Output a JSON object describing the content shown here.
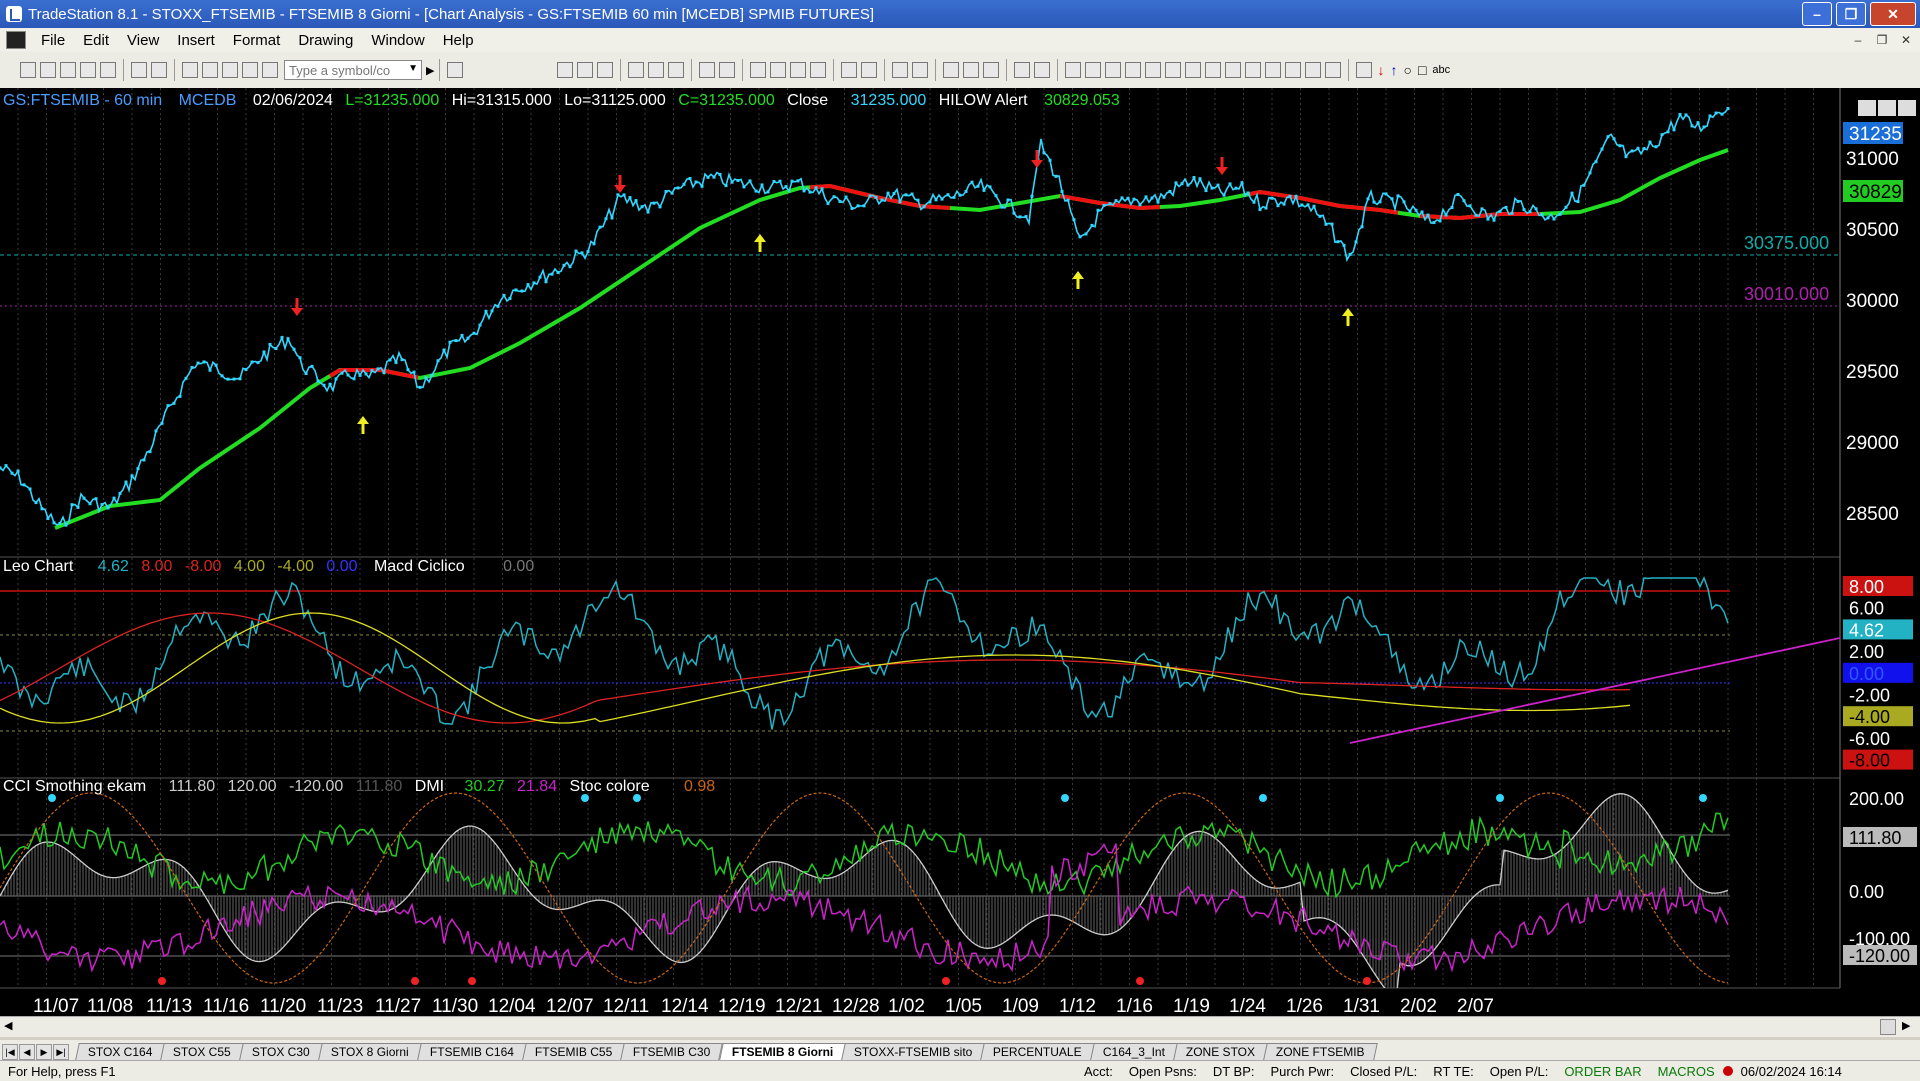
{
  "window": {
    "title": "TradeStation 8.1 - STOXX_FTSEMIB - FTSEMIB  8 Giorni - [Chart Analysis - GS:FTSEMIB  60 min  [MCEDB] SPMIB FUTURES]",
    "minimize": "–",
    "maximize": "❐",
    "close": "✕"
  },
  "menu": {
    "items": [
      "File",
      "Edit",
      "View",
      "Insert",
      "Format",
      "Drawing",
      "Window",
      "Help"
    ]
  },
  "toolbar": {
    "symbol_placeholder": "Type a symbol/co"
  },
  "chart": {
    "header": {
      "symbol": "GS:FTSEMIB - 60 min",
      "exchange": "MCEDB",
      "date": "02/06/2024",
      "last": "L=31235.000",
      "high": "Hi=31315.000",
      "low": "Lo=31125.000",
      "close": "C=31235.000",
      "close_label": "Close",
      "close_value": "31235.000",
      "alert_label": "HILOW Alert",
      "alert_value": "30829.053"
    },
    "price_axis": [
      "31000",
      "30500",
      "30000",
      "29500",
      "29000",
      "28500"
    ],
    "price_tags": {
      "last": "31235",
      "alert": "30829"
    },
    "level_labels": [
      "30375.000",
      "30010.000"
    ],
    "panel2": {
      "name": "Leo Chart",
      "v1": "4.62",
      "v2": "8.00",
      "v3": "-8.00",
      "v4": "4.00",
      "v5": "-4.00",
      "v6": "0.00",
      "name2": "Macd Ciclico",
      "v7": "0.00",
      "axis": [
        "8.00",
        "6.00",
        "4.62",
        "2.00",
        "0.00",
        "-2.00",
        "-4.00",
        "-6.00",
        "-8.00"
      ]
    },
    "panel3": {
      "name": "CCI Smothing ekam",
      "v1": "111.80",
      "v2": "120.00",
      "v3": "-120.00",
      "v4": "111.80",
      "name2": "DMI",
      "v5": "30.27",
      "v6": "21.84",
      "name3": "Stoc colore",
      "v7": "0.98",
      "axis": [
        "200.00",
        "111.80",
        "0.00",
        "-100.00",
        "-120.00"
      ]
    },
    "time_axis": [
      "11/07",
      "11/08",
      "11/13",
      "11/16",
      "11/20",
      "11/23",
      "11/27",
      "11/30",
      "12/04",
      "12/07",
      "12/11",
      "12/14",
      "12/19",
      "12/21",
      "12/28",
      "1/02",
      "1/05",
      "1/09",
      "1/12",
      "1/16",
      "1/19",
      "1/24",
      "1/26",
      "1/31",
      "2/02",
      "2/07"
    ]
  },
  "tabs": [
    "STOX C164",
    "STOX C55",
    "STOX  C30",
    "STOX  8 Giorni",
    "FTSEMIB C164",
    "FTSEMIB C55",
    "FTSEMIB C30",
    "FTSEMIB  8 Giorni",
    "STOXX-FTSEMIB sito",
    "PERCENTUALE",
    "C164_3_Int",
    "ZONE STOX",
    "ZONE FTSEMIB"
  ],
  "active_tab": "FTSEMIB  8 Giorni",
  "status": {
    "help": "For Help, press F1",
    "acct": "Acct:",
    "open_psns": "Open Psns:",
    "dt_bp": "DT BP:",
    "purch_pwr": "Purch Pwr:",
    "closed_pl": "Closed P/L:",
    "rt_te": "RT TE:",
    "open_pl": "Open P/L:",
    "order_bar": "ORDER BAR",
    "macros": "MACROS",
    "datetime": "06/02/2024 16:14"
  },
  "colors": {
    "price": "#33d6ff",
    "up_ma": "#22dd22",
    "down_ma": "#ee1111",
    "alert_box": "#22cc22",
    "level1": "#11aaaa",
    "level2": "#aa22aa"
  }
}
